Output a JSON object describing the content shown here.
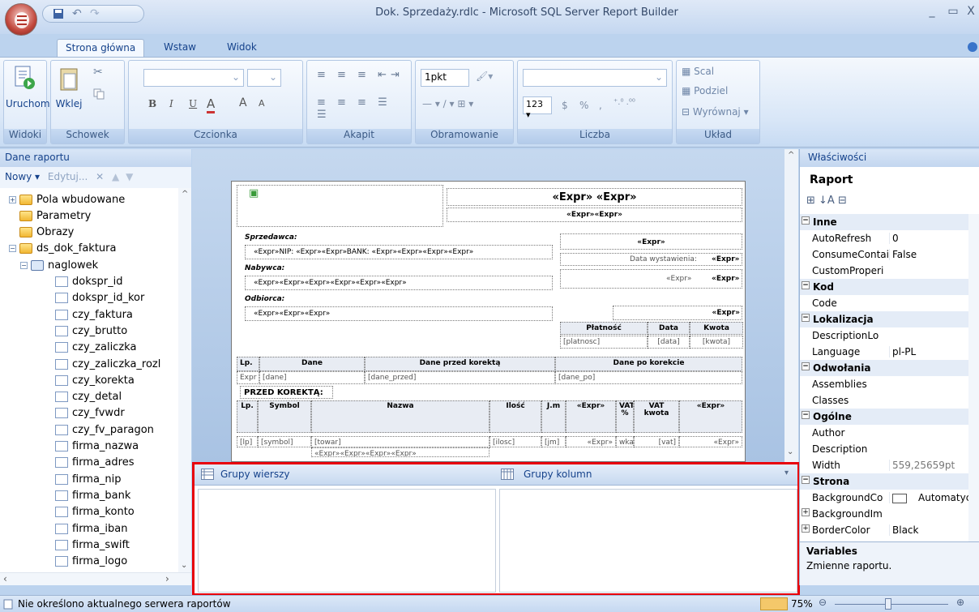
{
  "window": {
    "title": "Dok. Sprzedaży.rdlc - Microsoft SQL Server Report Builder",
    "min": "_",
    "max": "▭",
    "close": "X"
  },
  "tabs": [
    "Strona główna",
    "Wstaw",
    "Widok"
  ],
  "ribbon": {
    "run": "Uruchom",
    "paste": "Wklej",
    "groups": [
      "Widoki",
      "Schowek",
      "Czcionka",
      "Akapit",
      "Obramowanie",
      "Liczba",
      "Układ"
    ],
    "border_width": "1pkt",
    "number_format": "123 ▾",
    "currency": "$",
    "percent": "%",
    "comma": ",",
    "merge": "Scal",
    "split": "Podziel",
    "align": "Wyrównaj ▾",
    "bold": "B",
    "italic": "I",
    "underline": "U",
    "font_color": "A",
    "grow": "A",
    "shrink": "A"
  },
  "left_panel": {
    "title": "Dane raportu",
    "new": "Nowy ▾",
    "edit": "Edytuj...",
    "del": "✕",
    "tree": [
      {
        "label": "Pola wbudowane",
        "type": "folder",
        "indent": 0,
        "pm": "+"
      },
      {
        "label": "Parametry",
        "type": "folder",
        "indent": 0,
        "pm": ""
      },
      {
        "label": "Obrazy",
        "type": "folder",
        "indent": 0,
        "pm": ""
      },
      {
        "label": "ds_dok_faktura",
        "type": "dataset",
        "indent": 0,
        "pm": "−"
      },
      {
        "label": "naglowek",
        "type": "table",
        "indent": 1,
        "pm": "−"
      },
      {
        "label": "dokspr_id",
        "type": "field",
        "indent": 2,
        "pm": ""
      },
      {
        "label": "dokspr_id_kor",
        "type": "field",
        "indent": 2,
        "pm": ""
      },
      {
        "label": "czy_faktura",
        "type": "field",
        "indent": 2,
        "pm": ""
      },
      {
        "label": "czy_brutto",
        "type": "field",
        "indent": 2,
        "pm": ""
      },
      {
        "label": "czy_zaliczka",
        "type": "field",
        "indent": 2,
        "pm": ""
      },
      {
        "label": "czy_zaliczka_rozl",
        "type": "field",
        "indent": 2,
        "pm": ""
      },
      {
        "label": "czy_korekta",
        "type": "field",
        "indent": 2,
        "pm": ""
      },
      {
        "label": "czy_detal",
        "type": "field",
        "indent": 2,
        "pm": ""
      },
      {
        "label": "czy_fvwdr",
        "type": "field",
        "indent": 2,
        "pm": ""
      },
      {
        "label": "czy_fv_paragon",
        "type": "field",
        "indent": 2,
        "pm": ""
      },
      {
        "label": "firma_nazwa",
        "type": "field",
        "indent": 2,
        "pm": ""
      },
      {
        "label": "firma_adres",
        "type": "field",
        "indent": 2,
        "pm": ""
      },
      {
        "label": "firma_nip",
        "type": "field",
        "indent": 2,
        "pm": ""
      },
      {
        "label": "firma_bank",
        "type": "field",
        "indent": 2,
        "pm": ""
      },
      {
        "label": "firma_konto",
        "type": "field",
        "indent": 2,
        "pm": ""
      },
      {
        "label": "firma_iban",
        "type": "field",
        "indent": 2,
        "pm": ""
      },
      {
        "label": "firma_swift",
        "type": "field",
        "indent": 2,
        "pm": ""
      },
      {
        "label": "firma_logo",
        "type": "field",
        "indent": 2,
        "pm": ""
      }
    ]
  },
  "report": {
    "title": "«Expr» «Expr»",
    "subtitle": "«Expr»«Expr»",
    "seller": "Sprzedawca:",
    "seller_val": "«Expr»NIP: «Expr»«Expr»BANK: «Expr»«Expr»«Expr»«Expr»",
    "buyer": "Nabywca:",
    "buyer_val": "«Expr»«Expr»«Expr»«Expr»«Expr»«Expr»",
    "recipient": "Odbiorca:",
    "recipient_val": "«Expr»«Expr»«Expr»",
    "r_expr": "«Expr»",
    "issue_label": "Data wystawienia:",
    "r_expr2": "«Expr»",
    "r_expr3": "«Expr»",
    "r_expr4": "«Expr»",
    "r_expr5": "«Expr»",
    "pay_headers": [
      "Płatność",
      "Data",
      "Kwota"
    ],
    "pay_vals": [
      "[platnosc]",
      "[data]",
      "[kwota]"
    ],
    "corr_headers": [
      "Lp.",
      "Dane",
      "Dane przed korektą",
      "Dane po korekcie"
    ],
    "corr_vals": [
      "Expr",
      "[dane]",
      "[dane_przed]",
      "[dane_po]"
    ],
    "before": "PRZED KOREKTĄ:",
    "item_headers": [
      "Lp.",
      "Symbol",
      "Nazwa",
      "Ilość",
      "J.m",
      "«Expr»",
      "VAT %",
      "VAT kwota",
      "«Expr»"
    ],
    "item_vals": [
      "[lp]",
      "[symbol]",
      "[towar]",
      "[ilosc]",
      "[jm]",
      "«Expr»",
      "wka_",
      "[vat]",
      "«Expr»"
    ],
    "item_sub": "«Expr»«Expr»«Expr»«Expr»"
  },
  "groups": {
    "rows": "Grupy wierszy",
    "cols": "Grupy kolumn"
  },
  "right_panel": {
    "title": "Właściwości",
    "object": "Raport",
    "rows": [
      {
        "cat": true,
        "name": "Inne"
      },
      {
        "name": "AutoRefresh",
        "value": "0"
      },
      {
        "name": "ConsumeContai",
        "value": "False"
      },
      {
        "name": "CustomProperi",
        "value": ""
      },
      {
        "cat": true,
        "name": "Kod"
      },
      {
        "name": "Code",
        "value": ""
      },
      {
        "cat": true,
        "name": "Lokalizacja"
      },
      {
        "name": "DescriptionLo",
        "value": ""
      },
      {
        "name": "Language",
        "value": "pl-PL"
      },
      {
        "cat": true,
        "name": "Odwołania"
      },
      {
        "name": "Assemblies",
        "value": ""
      },
      {
        "name": "Classes",
        "value": ""
      },
      {
        "cat": true,
        "name": "Ogólne"
      },
      {
        "name": "Author",
        "value": ""
      },
      {
        "name": "Description",
        "value": ""
      },
      {
        "name": "Width",
        "value": "559,25659pt",
        "gray": true
      },
      {
        "cat": true,
        "name": "Strona"
      },
      {
        "name": "BackgroundCo",
        "value": "Automatyczn",
        "swatch": true
      },
      {
        "name": "BackgroundIm",
        "value": "",
        "expand": true
      },
      {
        "name": "BorderColor",
        "value": "Black",
        "expand": true
      }
    ],
    "desc_title": "Variables",
    "desc_text": "Zmienne raportu."
  },
  "status": {
    "text": "Nie określono aktualnego serwera raportów",
    "zoom": "75%"
  }
}
